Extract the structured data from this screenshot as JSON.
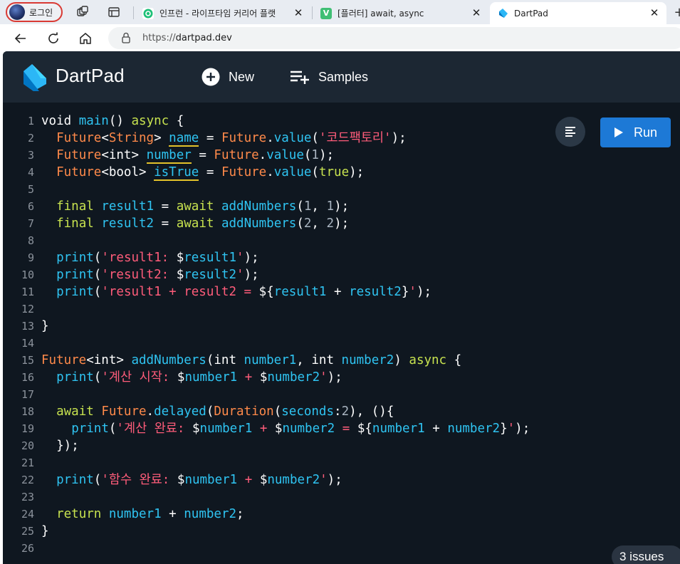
{
  "browser": {
    "profile_label": "로그인",
    "tabs": [
      {
        "title": "인프런 - 라이프타임 커리어 플랫",
        "active": false
      },
      {
        "title": "[플러터] await, async",
        "active": false
      },
      {
        "title": "DartPad",
        "active": true
      }
    ],
    "url": "https://dartpad.dev",
    "url_prefix": "https://",
    "url_host": "dartpad.dev"
  },
  "dartpad": {
    "brand": "DartPad",
    "new_label": "New",
    "samples_label": "Samples",
    "run_label": "Run",
    "issues_label": "3 issues"
  },
  "editor": {
    "line_numbers": [
      "1",
      "2",
      "3",
      "4",
      "5",
      "6",
      "7",
      "8",
      "9",
      "10",
      "11",
      "12",
      "13",
      "14",
      "15",
      "16",
      "17",
      "18",
      "19",
      "20",
      "21",
      "22",
      "23",
      "24",
      "25",
      "26"
    ],
    "lines": [
      "void main() async {",
      "  Future<String> name = Future.value('코드팩토리');",
      "  Future<int> number = Future.value(1);",
      "  Future<bool> isTrue = Future.value(true);",
      "",
      "  final result1 = await addNumbers(1, 1);",
      "  final result2 = await addNumbers(2, 2);",
      "",
      "  print('result1: $result1');",
      "  print('result2: $result2');",
      "  print('result1 + result2 = ${result1 + result2}');",
      "",
      "}",
      "",
      "Future<int> addNumbers(int number1, int number2) async {",
      "  print('계산 시작: $number1 + $number2');",
      "",
      "  await Future.delayed(Duration(seconds:2), (){",
      "    print('계산 완료: $number1 + $number2 = ${number1 + number2}');",
      "  });",
      "",
      "  print('함수 완료: $number1 + $number2');",
      "",
      "  return number1 + number2;",
      "}",
      ""
    ]
  },
  "colors": {
    "header_bg": "#1c2733",
    "editor_bg": "#0f1720",
    "keyword": "#c7e24f",
    "type": "#ff8a4a",
    "function": "#2fc4f2",
    "string": "#ff5c7a",
    "run_button": "#1d79d6",
    "warning_underline": "#e3c22a"
  }
}
